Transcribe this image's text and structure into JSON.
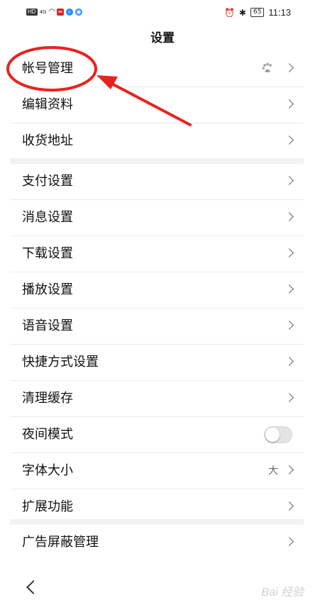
{
  "status_bar": {
    "left_chips": [
      "HD",
      "4G"
    ],
    "time": "11:13",
    "battery": "65"
  },
  "title": "设置",
  "groups": [
    {
      "items": [
        {
          "label": "帐号管理",
          "icon": "baidu-paw-icon"
        },
        {
          "label": "编辑资料"
        },
        {
          "label": "收货地址"
        }
      ]
    },
    {
      "items": [
        {
          "label": "支付设置"
        },
        {
          "label": "消息设置"
        },
        {
          "label": "下载设置"
        },
        {
          "label": "播放设置"
        },
        {
          "label": "语音设置"
        },
        {
          "label": "快捷方式设置"
        },
        {
          "label": "清理缓存"
        },
        {
          "label": "夜间模式",
          "toggle": "off"
        },
        {
          "label": "字体大小",
          "value": "大"
        },
        {
          "label": "扩展功能"
        }
      ]
    },
    {
      "items": [
        {
          "label": "广告屏蔽管理"
        }
      ]
    }
  ],
  "annotation_color": "#e8231f",
  "watermark": "Bai 经验"
}
